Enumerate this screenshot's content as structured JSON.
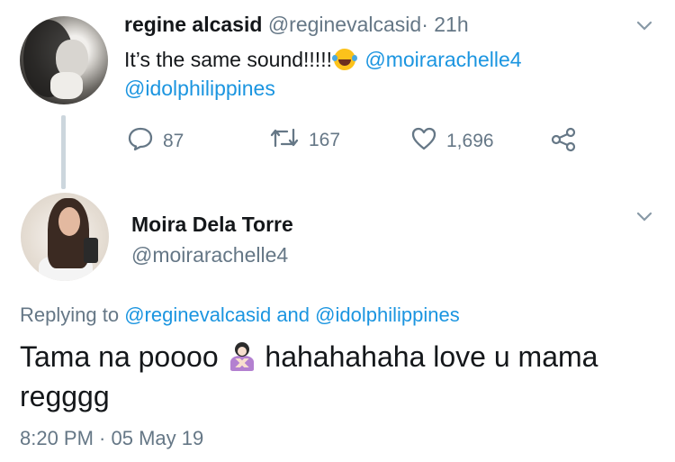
{
  "tweet1": {
    "name": "regine alcasid",
    "handle": "@reginevalcasid",
    "time": "· 21h",
    "text_before": "It’s the same sound!!!!!",
    "emoji": "face-with-tears-of-joy",
    "mention1": "@moirarachelle4",
    "mention2": "@idolphilippines",
    "replies": "87",
    "retweets": "167",
    "likes": "1,696"
  },
  "tweet2": {
    "name": "Moira Dela Torre",
    "handle": "@moirarachelle4",
    "replying_prefix": "Replying to",
    "replying_user1": "@reginevalcasid",
    "replying_and": "and",
    "replying_user2": "@idolphilippines",
    "text_part1": "Tama na poooo",
    "emoji": "person-gesturing-no",
    "text_part2": "hahahahaha love u mama",
    "text_part3": "regggg",
    "timestamp": "8:20 PM · 05 May 19"
  },
  "colors": {
    "link": "#1b95e0",
    "secondary": "#657786",
    "primary": "#14171a",
    "thread_line": "#ccd6dd"
  }
}
